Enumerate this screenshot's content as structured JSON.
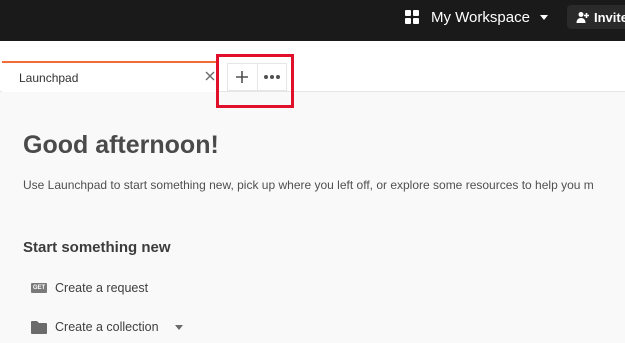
{
  "header": {
    "workspace_label": "My Workspace",
    "invite_label": "Invite"
  },
  "tabs": [
    {
      "label": "Launchpad",
      "active": true
    }
  ],
  "launchpad": {
    "greeting": "Good afternoon!",
    "subtitle": "Use Launchpad to start something new, pick up where you left off, or explore some resources to help you m",
    "section_title": "Start something new",
    "actions": [
      {
        "label": "Create a request",
        "icon_text": "GET"
      },
      {
        "label": "Create a collection"
      }
    ]
  },
  "colors": {
    "topbar": "#1a1a1a",
    "tab_accent": "#f26b3a",
    "highlight": "#e0102b"
  }
}
